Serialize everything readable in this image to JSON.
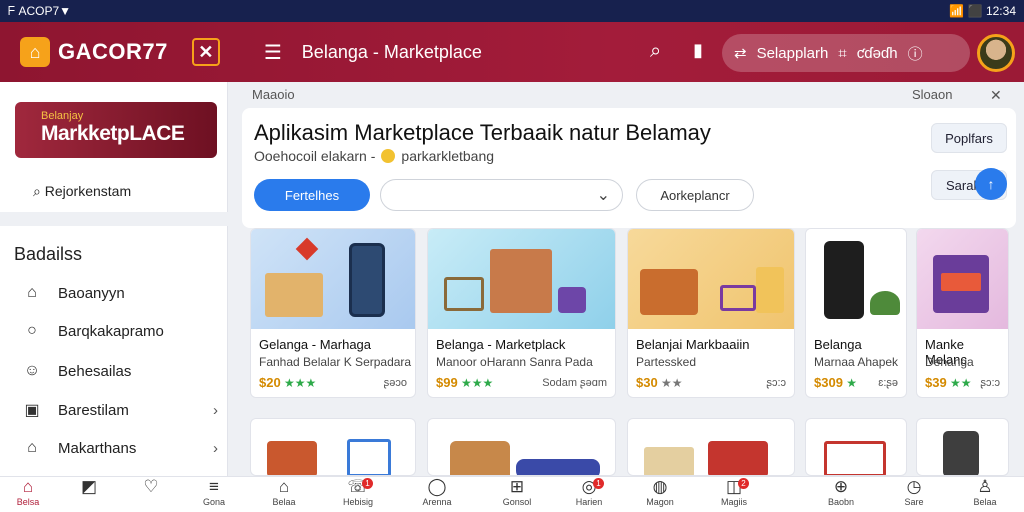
{
  "status_bar": {
    "left_text": "ᖴ ACOP7▼",
    "right_text": "📶 ⬛ 12:34"
  },
  "app_bar": {
    "brand": "GACOR77",
    "title": "Belanga - Marketplace",
    "pill_label": "Selapplarh",
    "pill_extra": "ƈɗəɗh"
  },
  "sidebar": {
    "banner_small": "Belanjay",
    "banner_big": "MarkketpLACE",
    "top_link": "Rejorkenstam",
    "heading": "Badailss",
    "items": [
      {
        "label": "Baoanyyn",
        "icon": "home-outline-icon",
        "chevron": false
      },
      {
        "label": "Barqkakapramo",
        "icon": "circle-icon",
        "chevron": false
      },
      {
        "label": "Behesailas",
        "icon": "smile-icon",
        "chevron": false
      },
      {
        "label": "Barestilam",
        "icon": "bag-icon",
        "chevron": true
      },
      {
        "label": "Makarthans",
        "icon": "store-icon",
        "chevron": true
      }
    ]
  },
  "breadcrumb": {
    "left": "Maaoio",
    "right": "Sloaon",
    "close": "✕"
  },
  "main": {
    "title": "Aplikasim Marketplace Terbaaik natur Belamay",
    "subtitle_a": "Ooehocoil elakarn -",
    "subtitle_b": "parkarkletbang",
    "filter_primary": "Fertelhes",
    "filter_select": "",
    "filter_secondary": "Aorkeplancr",
    "popular_button": "Poplfars",
    "sort_button": "Sarah"
  },
  "products": [
    {
      "title": "Gelanga - Marhaga",
      "desc": "Fanhad Belalar K Serpadara",
      "price": "$20",
      "rating": "ʂəɔo"
    },
    {
      "title": "Belanga - Marketplack",
      "desc": "Manoor oHarann Sanra Pada",
      "price": "$99",
      "rating": "Sodam   ʂəɑm"
    },
    {
      "title": "Belanjai Markbaaiin",
      "desc": "Partessked",
      "price": "$30",
      "rating": "ʂɔ:ɔ"
    },
    {
      "title": "Belanga",
      "desc": "Marnaa Ahapek",
      "price": "$309",
      "rating": "ɛ:ʂə"
    },
    {
      "title": "Manke Melanc",
      "desc": "Denanga",
      "price": "$39",
      "rating": "ʂɔ:ɔ"
    }
  ],
  "bottom_nav": [
    {
      "label": "Belsa",
      "icon": "home-icon",
      "active": true,
      "badge": ""
    },
    {
      "label": "",
      "icon": "tag-icon",
      "active": false,
      "badge": ""
    },
    {
      "label": "",
      "icon": "heart-icon",
      "active": false,
      "badge": ""
    },
    {
      "label": "Gona",
      "icon": "list-icon",
      "active": false,
      "badge": ""
    },
    {
      "label": "Belaa",
      "icon": "house-icon",
      "active": false,
      "badge": ""
    },
    {
      "label": "Hebisig",
      "icon": "chat-icon",
      "active": false,
      "badge": "1"
    },
    {
      "label": "Arenna",
      "icon": "bubble-icon",
      "active": false,
      "badge": ""
    },
    {
      "label": "Gonsol",
      "icon": "grid-icon",
      "active": false,
      "badge": ""
    },
    {
      "label": "Harien",
      "icon": "gamepad-icon",
      "active": false,
      "badge": "1"
    },
    {
      "label": "Magon",
      "icon": "globe-icon",
      "active": false,
      "badge": ""
    },
    {
      "label": "Magiis",
      "icon": "gift-icon",
      "active": false,
      "badge": "2"
    },
    {
      "label": "Baobn",
      "icon": "plus-circle-icon",
      "active": false,
      "badge": ""
    },
    {
      "label": "Sare",
      "icon": "clock-icon",
      "active": false,
      "badge": ""
    },
    {
      "label": "Belaa",
      "icon": "user-icon",
      "active": false,
      "badge": ""
    }
  ],
  "colors": {
    "brand": "#a31c3a",
    "accent": "#f6a21a",
    "primary_button": "#2a7bec",
    "status_bar": "#17214e"
  }
}
